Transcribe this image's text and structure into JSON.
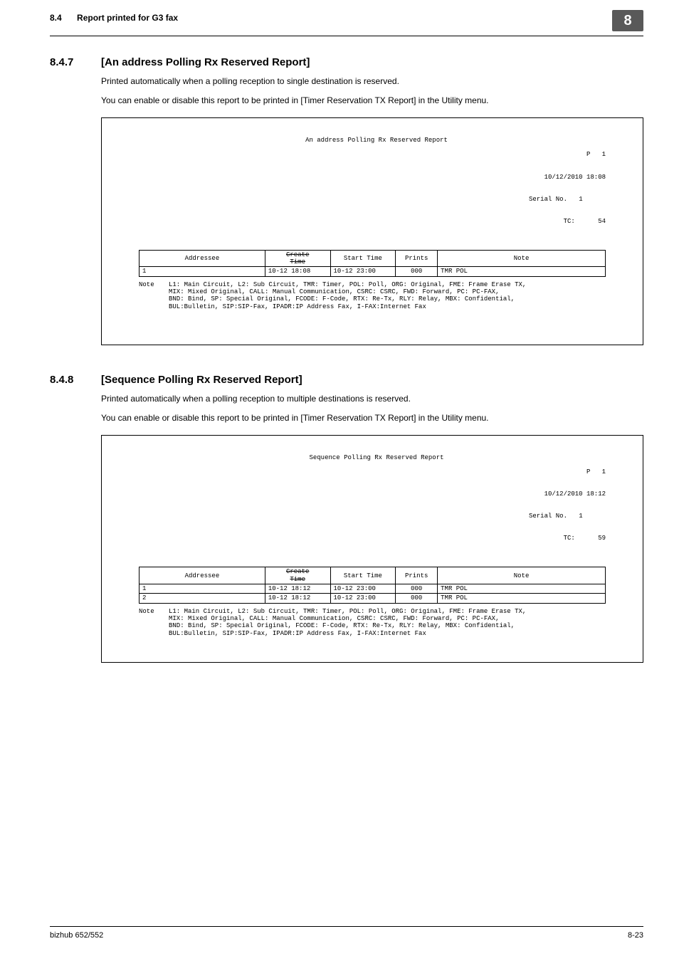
{
  "header": {
    "section_num": "8.4",
    "section_title": "Report printed for G3 fax",
    "chapter": "8"
  },
  "sections": [
    {
      "num": "8.4.7",
      "title": "[An address Polling Rx Reserved Report]",
      "para1": "Printed automatically when a polling reception to single destination is reserved.",
      "para2": "You can enable or disable this report to be printed in [Timer Reservation TX Report] in the Utility menu.",
      "report": {
        "title": "An address Polling Rx Reserved Report",
        "meta_p": "P   1",
        "meta_date": "10/12/2010 18:08",
        "meta_serial_lbl": "Serial No.",
        "meta_serial_val": "1",
        "meta_tc_lbl": "TC:",
        "meta_tc_val": "54",
        "cols": [
          "Addressee",
          "Create\nTime",
          "Start Time",
          "Prints",
          "Note"
        ],
        "rows": [
          [
            "1",
            "10-12 18:08",
            "10-12 23:00",
            "000",
            "TMR POL"
          ]
        ],
        "note_lbl": "Note",
        "note_body": "L1: Main Circuit, L2: Sub Circuit, TMR: Timer, POL: Poll, ORG: Original, FME: Frame Erase TX,\nMIX: Mixed Original, CALL: Manual Communication, CSRC: CSRC, FWD: Forward, PC: PC-FAX,\nBND: Bind, SP: Special Original, FCODE: F-Code, RTX: Re-Tx, RLY: Relay, MBX: Confidential,\nBUL:Bulletin, SIP:SIP-Fax, IPADR:IP Address Fax, I-FAX:Internet Fax"
      }
    },
    {
      "num": "8.4.8",
      "title": "[Sequence Polling Rx Reserved Report]",
      "para1": "Printed automatically when a polling reception to multiple destinations is reserved.",
      "para2": "You can enable or disable this report to be printed in [Timer Reservation TX Report] in the Utility menu.",
      "report": {
        "title": "Sequence Polling Rx Reserved Report",
        "meta_p": "P   1",
        "meta_date": "10/12/2010 18:12",
        "meta_serial_lbl": "Serial No.",
        "meta_serial_val": "1",
        "meta_tc_lbl": "TC:",
        "meta_tc_val": "59",
        "cols": [
          "Addressee",
          "Create\nTime",
          "Start Time",
          "Prints",
          "Note"
        ],
        "rows": [
          [
            "1",
            "10-12 18:12",
            "10-12 23:00",
            "000",
            "TMR POL"
          ],
          [
            "2",
            "10-12 18:12",
            "10-12 23:00",
            "000",
            "TMR POL"
          ]
        ],
        "note_lbl": "Note",
        "note_body": "L1: Main Circuit, L2: Sub Circuit, TMR: Timer, POL: Poll, ORG: Original, FME: Frame Erase TX,\nMIX: Mixed Original, CALL: Manual Communication, CSRC: CSRC, FWD: Forward, PC: PC-FAX,\nBND: Bind, SP: Special Original, FCODE: F-Code, RTX: Re-Tx, RLY: Relay, MBX: Confidential,\nBUL:Bulletin, SIP:SIP-Fax, IPADR:IP Address Fax, I-FAX:Internet Fax"
      }
    }
  ],
  "footer": {
    "left": "bizhub 652/552",
    "right": "8-23"
  }
}
